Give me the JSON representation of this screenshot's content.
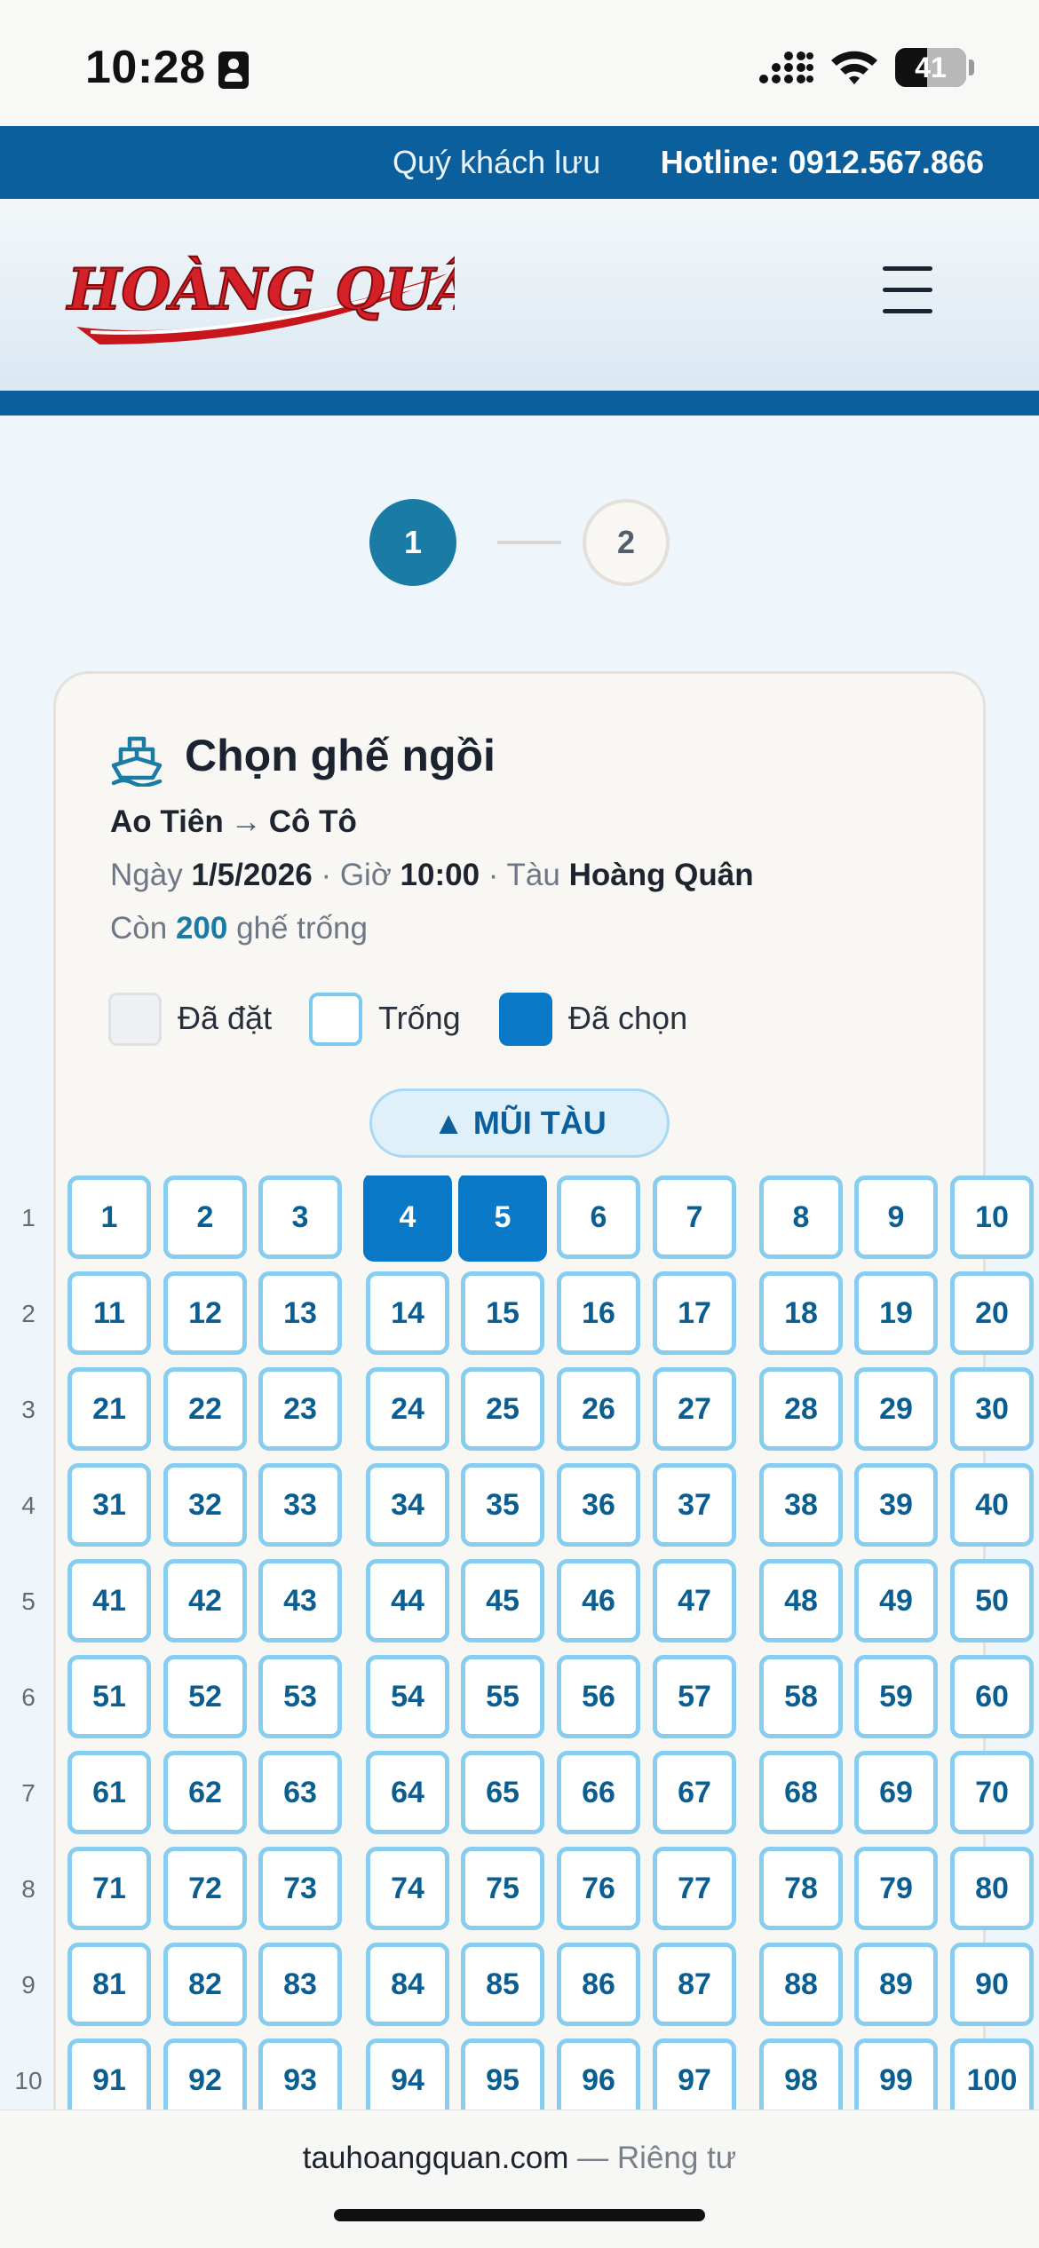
{
  "status_bar": {
    "time": "10:28",
    "battery": "41"
  },
  "topbar": {
    "marquee": "Quý khách lưu",
    "hotline": "Hotline: 0912.567.866"
  },
  "header": {
    "logo": "HOÀNG QUÂN",
    "menu_icon": "hamburger-icon"
  },
  "steps": [
    "1",
    "2"
  ],
  "card": {
    "title": "Chọn ghế ngồi",
    "route_from": "Ao Tiên",
    "route_arrow": "→",
    "route_to": "Cô Tô",
    "date_label": "Ngày",
    "date": "1/5/2026",
    "time_label": "· Giờ",
    "time": "10:00",
    "ship_label": "· Tàu",
    "ship": "Hoàng Quân",
    "remaining_prefix": "Còn",
    "remaining_count": "200",
    "remaining_suffix": "ghế trống"
  },
  "legend": {
    "booked": "Đã đặt",
    "free": "Trống",
    "selected": "Đã chọn"
  },
  "bow_label": "▲ MŨI TÀU",
  "seat_map": {
    "rows": [
      "1",
      "2",
      "3",
      "4",
      "5",
      "6",
      "7",
      "8",
      "9",
      "10"
    ],
    "seats_per_row": 10,
    "selected_seats": [
      4,
      5
    ]
  },
  "footer": {
    "domain": "tauhoangquan.com",
    "privacy": "— Riêng tư"
  },
  "colors": {
    "primary": "#0a5f9c",
    "selected": "#0878c7",
    "free_border": "#86cdf0",
    "logo_red": "#d42027"
  }
}
